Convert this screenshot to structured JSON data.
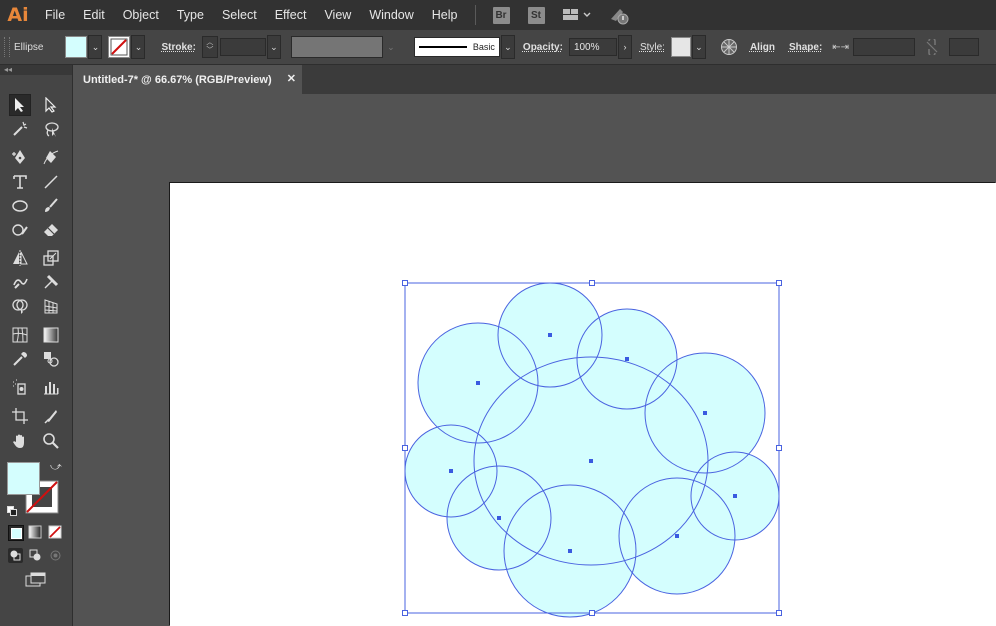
{
  "app": {
    "logo": "Ai"
  },
  "menu": [
    "File",
    "Edit",
    "Object",
    "Type",
    "Select",
    "Effect",
    "View",
    "Window",
    "Help"
  ],
  "menubar_icons": [
    "Br",
    "St",
    "workspace-switcher-icon",
    "gpu-performance-icon"
  ],
  "control_bar": {
    "selection": "Ellipse",
    "fill_color": "#d4fefe",
    "stroke_label": "Stroke:",
    "brush_name": "Basic",
    "opacity_label": "Opacity:",
    "opacity_value": "100%",
    "style_label": "Style:",
    "align_label": "Align",
    "shape_label": "Shape:"
  },
  "document_tab": {
    "title": "Untitled-7* @ 66.67% (RGB/Preview)",
    "close": "✕"
  },
  "toolbar": {
    "collapse": "◂◂"
  },
  "colors": {
    "fill": "#d4fefe",
    "stroke": "#4a63e0",
    "selection": "#4a63e0",
    "anchor": "#3a5ae0"
  }
}
